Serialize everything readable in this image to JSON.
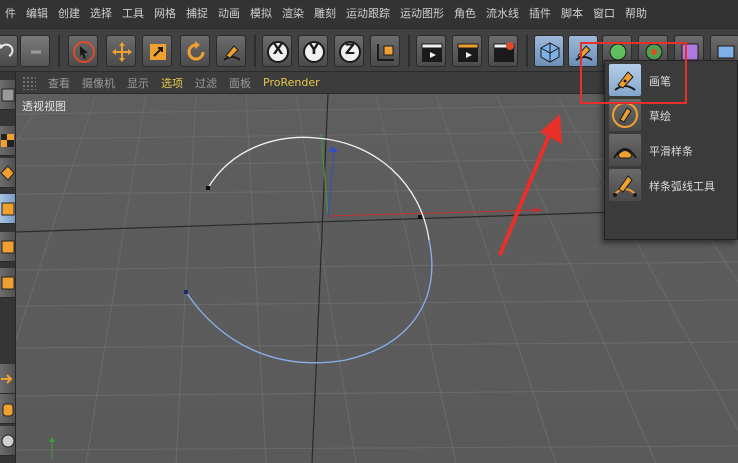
{
  "menubar": {
    "items": [
      "件",
      "编辑",
      "创建",
      "选择",
      "工具",
      "网格",
      "捕捉",
      "动画",
      "模拟",
      "渲染",
      "雕刻",
      "运动跟踪",
      "运动图形",
      "角色",
      "流水线",
      "插件",
      "脚本",
      "窗口",
      "帮助"
    ]
  },
  "viewport_menu": {
    "items": [
      "查看",
      "摄像机",
      "显示",
      "选项",
      "过滤",
      "面板",
      "ProRender"
    ],
    "active": "选项"
  },
  "viewport": {
    "label": "透视视图"
  },
  "toolbar": {
    "axis_x": "X",
    "axis_y": "Y",
    "axis_z": "Z"
  },
  "popup_menu": {
    "items": [
      {
        "label": "画笔",
        "icon": "pen-icon",
        "selected": true
      },
      {
        "label": "草绘",
        "icon": "sketch-icon",
        "selected": false
      },
      {
        "label": "平滑样条",
        "icon": "smooth-spline-icon",
        "selected": false
      },
      {
        "label": "样条弧线工具",
        "icon": "spline-arc-icon",
        "selected": false
      }
    ]
  },
  "colors": {
    "highlight_red": "#e8302a",
    "active_menu": "#e6c84a",
    "accent_orange": "#f0a030",
    "viewport_bg": "#5c5c5c"
  }
}
